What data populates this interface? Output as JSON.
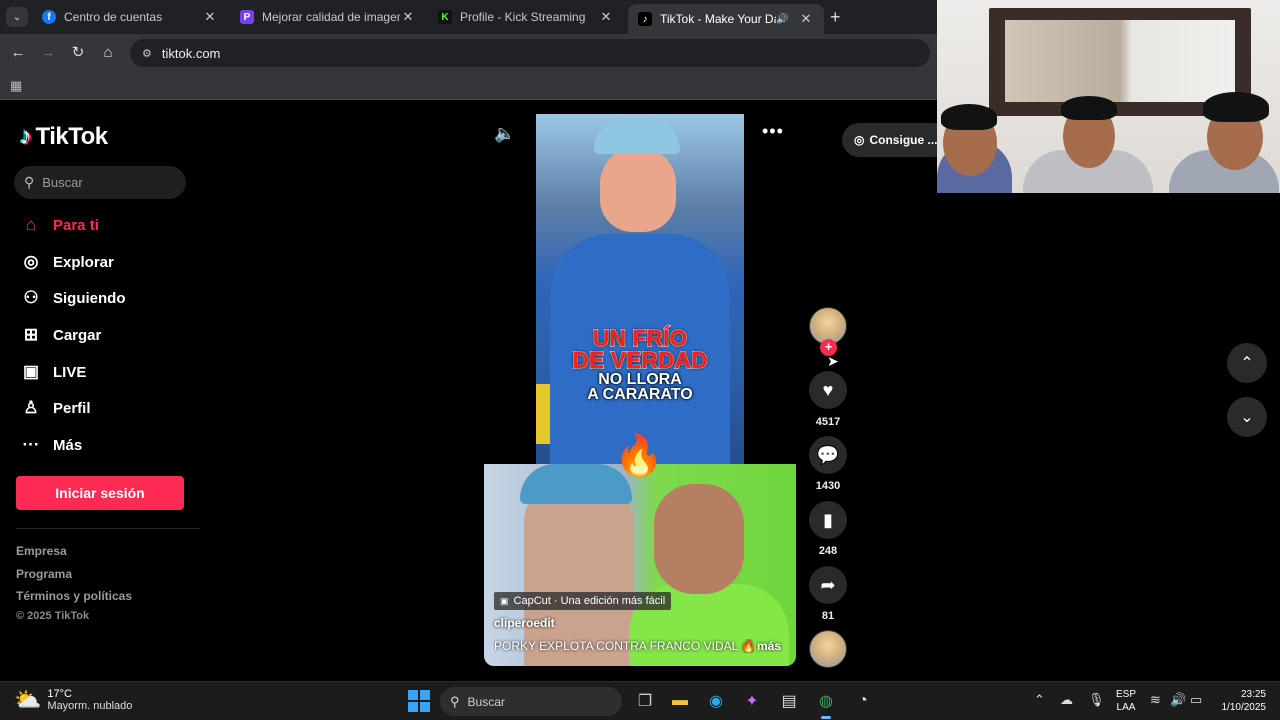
{
  "browser": {
    "tabs": [
      {
        "title": "Centro de cuentas",
        "favicon": "facebook-icon",
        "active": false
      },
      {
        "title": "Mejorar calidad de imagen online",
        "favicon": "image-enhancer-icon",
        "active": false
      },
      {
        "title": "Profile - Kick Streaming",
        "favicon": "kick-icon",
        "active": false
      },
      {
        "title": "TikTok - Make Your Day",
        "favicon": "tiktok-icon",
        "active": true,
        "audio": true
      }
    ],
    "url": "tiktok.com"
  },
  "tiktok": {
    "logo": "TikTok",
    "search_placeholder": "Buscar",
    "nav": [
      {
        "label": "Para ti",
        "icon": "home-icon",
        "active": true
      },
      {
        "label": "Explorar",
        "icon": "compass-icon"
      },
      {
        "label": "Siguiendo",
        "icon": "following-icon"
      },
      {
        "label": "Cargar",
        "icon": "upload-icon"
      },
      {
        "label": "LIVE",
        "icon": "live-icon"
      },
      {
        "label": "Perfil",
        "icon": "profile-icon"
      },
      {
        "label": "Más",
        "icon": "more-dots-icon"
      }
    ],
    "login_button": "Iniciar sesión",
    "footer_links": [
      "Empresa",
      "Programa",
      "Términos y políticas"
    ],
    "copyright": "© 2025 TikTok",
    "get_coins": "Consigue ...",
    "video": {
      "overlay_line1": "UN FRÍO",
      "overlay_line2": "DE VERDAD",
      "overlay_line3": "NO LLORA",
      "overlay_line4": "A CARARATO",
      "capcut_label": "CapCut · Una edición más fácil",
      "author": "cliperoedit",
      "description": "PORKY EXPLOTA CONTRA FRANCO VIDAL 🔥 ...",
      "more_label": "más"
    },
    "actions": {
      "likes": "4517",
      "comments": "1430",
      "saves": "248",
      "shares": "81"
    }
  },
  "taskbar": {
    "temperature": "17°C",
    "weather_desc": "Mayorm. nublado",
    "search_placeholder": "Buscar",
    "lang_line1": "ESP",
    "lang_line2": "LAA",
    "time": "23:25",
    "date": "1/10/2025"
  },
  "colors": {
    "tiktok_accent": "#fe2c55",
    "browser_bg": "#202124",
    "toolbar_bg": "#35363a",
    "taskbar_bg": "#1c1c1c"
  }
}
